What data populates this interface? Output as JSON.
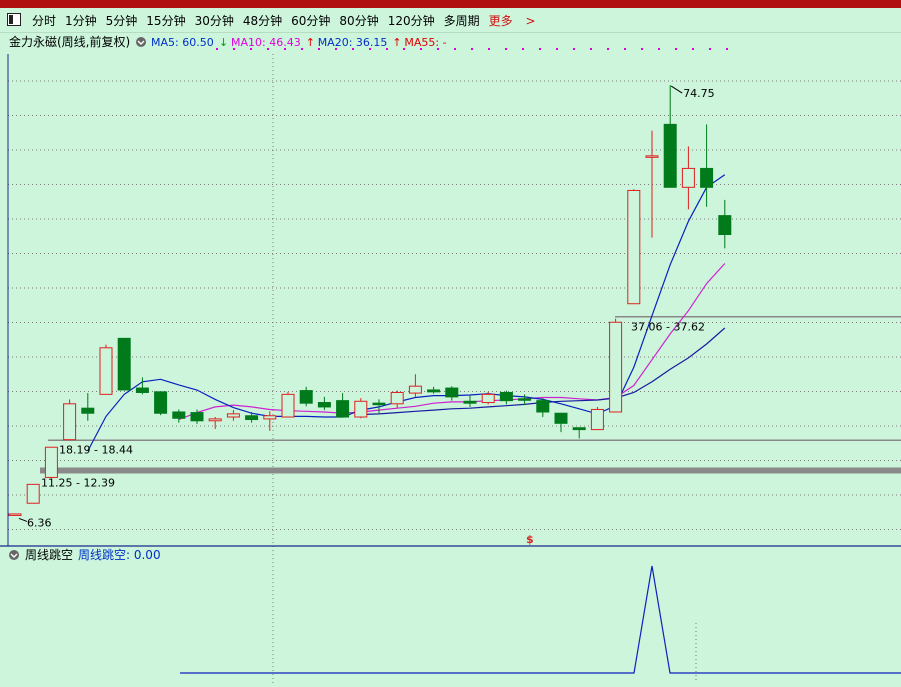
{
  "period_bar": {
    "items": [
      "分时",
      "1分钟",
      "5分钟",
      "15分钟",
      "30分钟",
      "48分钟",
      "60分钟",
      "80分钟",
      "120分钟",
      "多周期"
    ],
    "more_label": "更多"
  },
  "main_chart": {
    "stock_name": "金力永磁(周线,前复权)",
    "ma_labels": [
      {
        "text": "MA5: 60.50",
        "arrow": "↓",
        "color": "#0030c8",
        "arrow_color": "#00a000"
      },
      {
        "text": "MA10: 46.43",
        "arrow": "↑",
        "color": "#e000e0",
        "arrow_color": "#e00000"
      },
      {
        "text": "MA20: 36.15",
        "arrow": "↑",
        "color": "#0030c8",
        "arrow_color": "#e00000"
      },
      {
        "text": "MA55: -",
        "arrow": "",
        "color": "#e00000",
        "arrow_color": "#e00000"
      }
    ],
    "annotations": {
      "high": "74.75",
      "low": "6.36",
      "zone1": "37.06 - 37.62",
      "zone2": "18.19 - 18.44",
      "zone3": "11.25 - 12.39",
      "marker": "$"
    },
    "colors": {
      "up": "#e02020",
      "down": "#007a1a",
      "ma5": "#0a20c0",
      "ma10": "#d020d0",
      "ma20": "#1a1aa0",
      "grid": "#7a7a7a"
    }
  },
  "chart_data": {
    "type": "candlestick",
    "y_range": [
      5,
      80
    ],
    "candles": [
      {
        "o": 6.4,
        "h": 6.6,
        "l": 6.36,
        "c": 6.6
      },
      {
        "o": 8.3,
        "h": 11.3,
        "l": 8.3,
        "c": 11.3
      },
      {
        "o": 12.4,
        "h": 17.2,
        "l": 12.4,
        "c": 17.2
      },
      {
        "o": 18.4,
        "h": 24.8,
        "l": 18.4,
        "c": 24.1
      },
      {
        "o": 23.4,
        "h": 25.8,
        "l": 21.4,
        "c": 22.6
      },
      {
        "o": 25.6,
        "h": 33.5,
        "l": 25.6,
        "c": 33.0
      },
      {
        "o": 34.5,
        "h": 34.5,
        "l": 26.3,
        "c": 26.3
      },
      {
        "o": 26.6,
        "h": 28.3,
        "l": 25.6,
        "c": 25.9
      },
      {
        "o": 26.0,
        "h": 26.0,
        "l": 22.3,
        "c": 22.6
      },
      {
        "o": 22.8,
        "h": 23.2,
        "l": 21.1,
        "c": 21.8
      },
      {
        "o": 22.7,
        "h": 23.2,
        "l": 20.9,
        "c": 21.4
      },
      {
        "o": 21.4,
        "h": 22.0,
        "l": 20.1,
        "c": 21.7
      },
      {
        "o": 22.0,
        "h": 23.1,
        "l": 21.4,
        "c": 22.5
      },
      {
        "o": 22.2,
        "h": 22.8,
        "l": 21.1,
        "c": 21.6
      },
      {
        "o": 21.7,
        "h": 22.9,
        "l": 19.8,
        "c": 22.2
      },
      {
        "o": 22.0,
        "h": 26.0,
        "l": 22.0,
        "c": 25.6
      },
      {
        "o": 26.2,
        "h": 26.8,
        "l": 23.7,
        "c": 24.2
      },
      {
        "o": 24.3,
        "h": 25.2,
        "l": 23.1,
        "c": 23.6
      },
      {
        "o": 24.6,
        "h": 25.8,
        "l": 21.9,
        "c": 22.0
      },
      {
        "o": 22.0,
        "h": 25.0,
        "l": 21.8,
        "c": 24.5
      },
      {
        "o": 24.2,
        "h": 24.8,
        "l": 22.5,
        "c": 24.1
      },
      {
        "o": 24.1,
        "h": 26.2,
        "l": 23.4,
        "c": 25.9
      },
      {
        "o": 25.8,
        "h": 28.8,
        "l": 25.2,
        "c": 26.9
      },
      {
        "o": 26.3,
        "h": 26.8,
        "l": 25.7,
        "c": 26.0
      },
      {
        "o": 26.6,
        "h": 26.9,
        "l": 24.6,
        "c": 25.2
      },
      {
        "o": 24.5,
        "h": 25.4,
        "l": 23.6,
        "c": 24.2
      },
      {
        "o": 24.3,
        "h": 26.0,
        "l": 24.0,
        "c": 25.6
      },
      {
        "o": 25.9,
        "h": 26.2,
        "l": 24.0,
        "c": 24.6
      },
      {
        "o": 24.9,
        "h": 25.6,
        "l": 23.9,
        "c": 24.7
      },
      {
        "o": 24.6,
        "h": 25.0,
        "l": 22.0,
        "c": 22.8
      },
      {
        "o": 22.6,
        "h": 22.6,
        "l": 19.6,
        "c": 21.0
      },
      {
        "o": 20.3,
        "h": 20.3,
        "l": 18.6,
        "c": 20.0
      },
      {
        "o": 20.0,
        "h": 23.6,
        "l": 20.0,
        "c": 23.2
      },
      {
        "o": 22.8,
        "h": 37.62,
        "l": 22.8,
        "c": 37.06
      },
      {
        "o": 40.0,
        "h": 58.2,
        "l": 40.0,
        "c": 58.0
      },
      {
        "o": 63.5,
        "h": 67.5,
        "l": 50.5,
        "c": 63.5
      },
      {
        "o": 68.5,
        "h": 74.75,
        "l": 58.5,
        "c": 58.5
      },
      {
        "o": 58.5,
        "h": 65.0,
        "l": 55.0,
        "c": 61.5
      },
      {
        "o": 61.5,
        "h": 68.5,
        "l": 55.4,
        "c": 58.5
      },
      {
        "o": 54.0,
        "h": 56.5,
        "l": 48.8,
        "c": 51.0
      }
    ],
    "ma5": [
      null,
      null,
      null,
      null,
      16.6,
      22.1,
      25.6,
      27.6,
      28.0,
      27.1,
      26.3,
      24.8,
      23.5,
      22.6,
      22.1,
      22.1,
      22.1,
      22.0,
      22.0,
      23.1,
      23.6,
      24.4,
      25.1,
      25.4,
      25.4,
      25.5,
      25.7,
      25.4,
      25.2,
      24.8,
      24.1,
      23.3,
      22.5,
      23.8,
      29.9,
      38.1,
      46.2,
      53.1,
      58.5,
      60.5
    ],
    "ma10": [
      null,
      null,
      null,
      null,
      null,
      null,
      null,
      null,
      null,
      21.6,
      22.7,
      23.6,
      23.9,
      23.6,
      23.2,
      23.0,
      22.9,
      22.8,
      22.6,
      22.8,
      23.1,
      23.4,
      23.7,
      24.2,
      24.4,
      24.4,
      24.6,
      24.7,
      24.9,
      25.1,
      25.1,
      24.9,
      24.7,
      25.1,
      27.0,
      31.1,
      35.2,
      38.9,
      43.2,
      46.4
    ],
    "ma20": [
      null,
      null,
      null,
      null,
      null,
      null,
      null,
      null,
      null,
      null,
      null,
      null,
      null,
      null,
      null,
      null,
      null,
      null,
      null,
      22.4,
      22.5,
      22.7,
      22.9,
      23.1,
      23.3,
      23.4,
      23.6,
      23.8,
      24.0,
      24.3,
      24.5,
      24.6,
      24.7,
      25.0,
      25.9,
      27.6,
      29.6,
      31.4,
      33.6,
      36.15
    ],
    "zone_lines": [
      {
        "y": 37.62
      },
      {
        "y": 18.3
      },
      {
        "y": 12.39
      }
    ],
    "sub_panel": {
      "title": "周线跳空",
      "label": "周线跳空: 0.00",
      "peak_at_candle": 35
    }
  }
}
